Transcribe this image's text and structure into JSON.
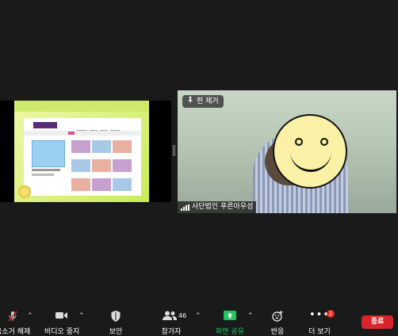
{
  "share": {},
  "video": {
    "unpin_label": "핀 제거",
    "participant_name": "사단법인 푸른아우성"
  },
  "toolbar": {
    "mute_label": "음소거 해제",
    "video_label": "비디오 중지",
    "security_label": "보안",
    "participants_label": "참가자",
    "participants_count": "46",
    "share_label": "화면 공유",
    "reactions_label": "반응",
    "more_label": "더 보기",
    "more_badge": "2",
    "end_label": "종료"
  },
  "colors": {
    "background": "#1a1a1a",
    "share_green": "#22c55e",
    "end_red": "#d6252b"
  },
  "icons": [
    "mic-muted-icon",
    "video-camera-icon",
    "shield-icon",
    "participants-icon",
    "share-screen-icon",
    "reaction-icon",
    "more-icon",
    "pin-icon",
    "signal-icon"
  ]
}
